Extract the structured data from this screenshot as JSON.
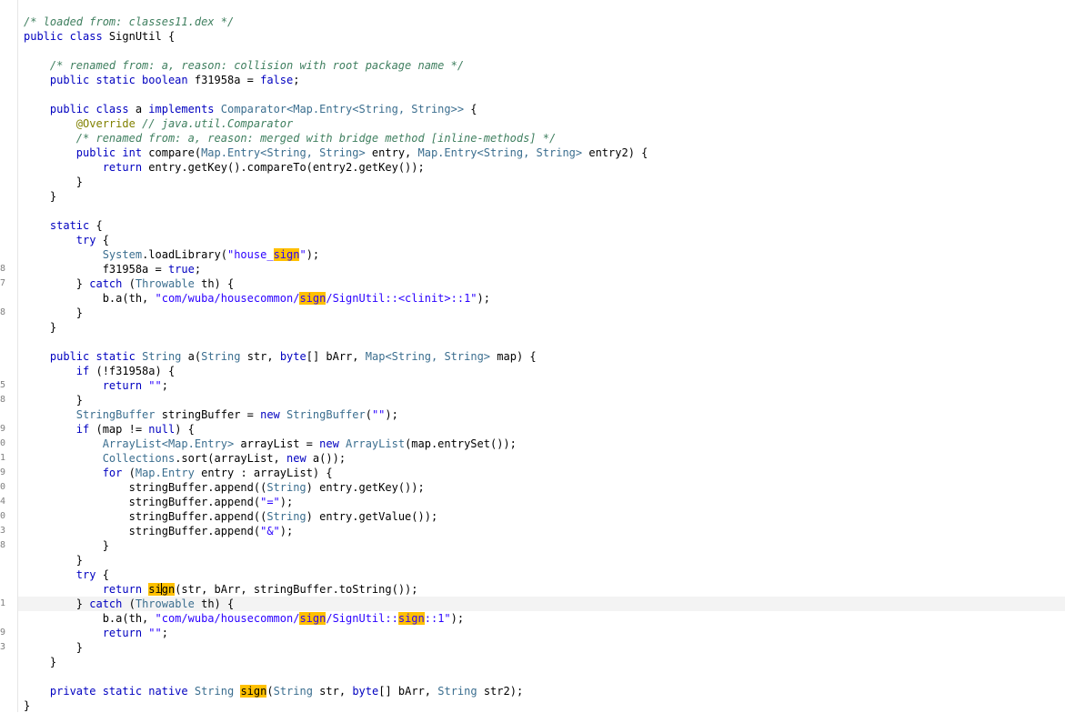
{
  "gutter": {
    "line_numbers": [
      {
        "line": 17,
        "text": "8"
      },
      {
        "line": 18,
        "text": "7"
      },
      {
        "line": 20,
        "text": "8"
      },
      {
        "line": 25,
        "text": "5"
      },
      {
        "line": 26,
        "text": "8"
      },
      {
        "line": 28,
        "text": "9"
      },
      {
        "line": 29,
        "text": "0"
      },
      {
        "line": 30,
        "text": "1"
      },
      {
        "line": 31,
        "text": "9"
      },
      {
        "line": 32,
        "text": "0"
      },
      {
        "line": 33,
        "text": "4"
      },
      {
        "line": 34,
        "text": "0"
      },
      {
        "line": 35,
        "text": "3"
      },
      {
        "line": 36,
        "text": "8"
      },
      {
        "line": 40,
        "text": "1"
      },
      {
        "line": 42,
        "text": "9"
      },
      {
        "line": 43,
        "text": "3"
      }
    ]
  },
  "editor": {
    "current_line_index": 40,
    "search_highlight": "sign",
    "lines": [
      [
        [
          "com",
          "/* loaded from: classes11.dex */"
        ]
      ],
      [
        [
          "kw",
          "public class "
        ],
        [
          "",
          "SignUtil {"
        ]
      ],
      [],
      [
        [
          "",
          "    "
        ],
        [
          "com",
          "/* renamed from: a, reason: collision with root package name */"
        ]
      ],
      [
        [
          "",
          "    "
        ],
        [
          "kw",
          "public static boolean "
        ],
        [
          "",
          "f31958a = "
        ],
        [
          "kw",
          "false"
        ],
        [
          "",
          ";"
        ]
      ],
      [],
      [
        [
          "",
          "    "
        ],
        [
          "kw",
          "public class "
        ],
        [
          "",
          "a "
        ],
        [
          "kw",
          "implements "
        ],
        [
          "typ",
          "Comparator<Map.Entry<String, String>>"
        ],
        [
          "",
          " {"
        ]
      ],
      [
        [
          "",
          "        "
        ],
        [
          "ann",
          "@Override"
        ],
        [
          "",
          " "
        ],
        [
          "com",
          "// java.util.Comparator"
        ]
      ],
      [
        [
          "",
          "        "
        ],
        [
          "com",
          "/* renamed from: a, reason: merged with bridge method [inline-methods] */"
        ]
      ],
      [
        [
          "",
          "        "
        ],
        [
          "kw",
          "public int "
        ],
        [
          "",
          "compare("
        ],
        [
          "typ",
          "Map.Entry<String, String>"
        ],
        [
          "",
          " entry, "
        ],
        [
          "typ",
          "Map.Entry<String, String>"
        ],
        [
          "",
          " entry2) {"
        ]
      ],
      [
        [
          "",
          "            "
        ],
        [
          "kw",
          "return "
        ],
        [
          "",
          "entry.getKey().compareTo(entry2.getKey());"
        ]
      ],
      [
        [
          "",
          "        }"
        ]
      ],
      [
        [
          "",
          "    }"
        ]
      ],
      [],
      [
        [
          "",
          "    "
        ],
        [
          "kw",
          "static "
        ],
        [
          "",
          "{"
        ]
      ],
      [
        [
          "",
          "        "
        ],
        [
          "kw",
          "try "
        ],
        [
          "",
          "{"
        ]
      ],
      [
        [
          "",
          "            "
        ],
        [
          "typ",
          "System"
        ],
        [
          "",
          ".loadLibrary("
        ],
        [
          "str",
          "\"house_"
        ],
        [
          "strhl",
          "sign"
        ],
        [
          "str",
          "\""
        ],
        [
          "",
          ");"
        ]
      ],
      [
        [
          "",
          "            f31958a = "
        ],
        [
          "kw",
          "true"
        ],
        [
          "",
          ";"
        ]
      ],
      [
        [
          "",
          "        } "
        ],
        [
          "kw",
          "catch "
        ],
        [
          "",
          "("
        ],
        [
          "typ",
          "Throwable"
        ],
        [
          "",
          " th) {"
        ]
      ],
      [
        [
          "",
          "            b.a(th, "
        ],
        [
          "str",
          "\"com/wuba/housecommon/"
        ],
        [
          "strhl",
          "sign"
        ],
        [
          "str",
          "/SignUtil::<clinit>::1\""
        ],
        [
          "",
          ");"
        ]
      ],
      [
        [
          "",
          "        }"
        ]
      ],
      [
        [
          "",
          "    }"
        ]
      ],
      [],
      [
        [
          "",
          "    "
        ],
        [
          "kw",
          "public static "
        ],
        [
          "typ",
          "String"
        ],
        [
          "",
          " a("
        ],
        [
          "typ",
          "String"
        ],
        [
          "",
          " str, "
        ],
        [
          "kw",
          "byte"
        ],
        [
          "",
          "[] bArr, "
        ],
        [
          "typ",
          "Map<String, String>"
        ],
        [
          "",
          " map) {"
        ]
      ],
      [
        [
          "",
          "        "
        ],
        [
          "kw",
          "if "
        ],
        [
          "",
          "(!f31958a) {"
        ]
      ],
      [
        [
          "",
          "            "
        ],
        [
          "kw",
          "return "
        ],
        [
          "str",
          "\"\""
        ],
        [
          "",
          ";"
        ]
      ],
      [
        [
          "",
          "        }"
        ]
      ],
      [
        [
          "",
          "        "
        ],
        [
          "typ",
          "StringBuffer"
        ],
        [
          "",
          " stringBuffer = "
        ],
        [
          "kw",
          "new "
        ],
        [
          "typ",
          "StringBuffer"
        ],
        [
          "",
          "("
        ],
        [
          "str",
          "\"\""
        ],
        [
          "",
          ");"
        ]
      ],
      [
        [
          "",
          "        "
        ],
        [
          "kw",
          "if "
        ],
        [
          "",
          "(map != "
        ],
        [
          "kw",
          "null"
        ],
        [
          "",
          ") {"
        ]
      ],
      [
        [
          "",
          "            "
        ],
        [
          "typ",
          "ArrayList<Map.Entry>"
        ],
        [
          "",
          " arrayList = "
        ],
        [
          "kw",
          "new "
        ],
        [
          "typ",
          "ArrayList"
        ],
        [
          "",
          "(map.entrySet());"
        ]
      ],
      [
        [
          "",
          "            "
        ],
        [
          "typ",
          "Collections"
        ],
        [
          "",
          ".sort(arrayList, "
        ],
        [
          "kw",
          "new "
        ],
        [
          "",
          "a());"
        ]
      ],
      [
        [
          "",
          "            "
        ],
        [
          "kw",
          "for "
        ],
        [
          "",
          "("
        ],
        [
          "typ",
          "Map.Entry"
        ],
        [
          "",
          " entry : arrayList) {"
        ]
      ],
      [
        [
          "",
          "                stringBuffer.append(("
        ],
        [
          "typ",
          "String"
        ],
        [
          "",
          ") entry.getKey());"
        ]
      ],
      [
        [
          "",
          "                stringBuffer.append("
        ],
        [
          "str",
          "\"=\""
        ],
        [
          "",
          ");"
        ]
      ],
      [
        [
          "",
          "                stringBuffer.append(("
        ],
        [
          "typ",
          "String"
        ],
        [
          "",
          ") entry.getValue());"
        ]
      ],
      [
        [
          "",
          "                stringBuffer.append("
        ],
        [
          "str",
          "\"&\""
        ],
        [
          "",
          ");"
        ]
      ],
      [
        [
          "",
          "            }"
        ]
      ],
      [
        [
          "",
          "        }"
        ]
      ],
      [
        [
          "",
          "        "
        ],
        [
          "kw",
          "try "
        ],
        [
          "",
          "{"
        ]
      ],
      [
        [
          "",
          "            "
        ],
        [
          "kw",
          "return "
        ],
        [
          "hl",
          "si"
        ],
        [
          "caret",
          ""
        ],
        [
          "hl",
          "gn"
        ],
        [
          "",
          "(str, bArr, stringBuffer.toString());"
        ]
      ],
      [
        [
          "",
          "        } "
        ],
        [
          "kw",
          "catch "
        ],
        [
          "",
          "("
        ],
        [
          "typ",
          "Throwable"
        ],
        [
          "",
          " th) {"
        ]
      ],
      [
        [
          "",
          "            b.a(th, "
        ],
        [
          "str",
          "\"com/wuba/housecommon/"
        ],
        [
          "strhl",
          "sign"
        ],
        [
          "str",
          "/SignUtil::"
        ],
        [
          "strhl",
          "sign"
        ],
        [
          "str",
          "::1\""
        ],
        [
          "",
          ");"
        ]
      ],
      [
        [
          "",
          "            "
        ],
        [
          "kw",
          "return "
        ],
        [
          "str",
          "\"\""
        ],
        [
          "",
          ";"
        ]
      ],
      [
        [
          "",
          "        }"
        ]
      ],
      [
        [
          "",
          "    }"
        ]
      ],
      [],
      [
        [
          "",
          "    "
        ],
        [
          "kw",
          "private static native "
        ],
        [
          "typ",
          "String"
        ],
        [
          "",
          " "
        ],
        [
          "hl",
          "sign"
        ],
        [
          "",
          "("
        ],
        [
          "typ",
          "String"
        ],
        [
          "",
          " str, "
        ],
        [
          "kw",
          "byte"
        ],
        [
          "",
          "[] bArr, "
        ],
        [
          "typ",
          "String"
        ],
        [
          "",
          " str2);"
        ]
      ],
      [
        [
          "",
          "}"
        ]
      ]
    ]
  }
}
